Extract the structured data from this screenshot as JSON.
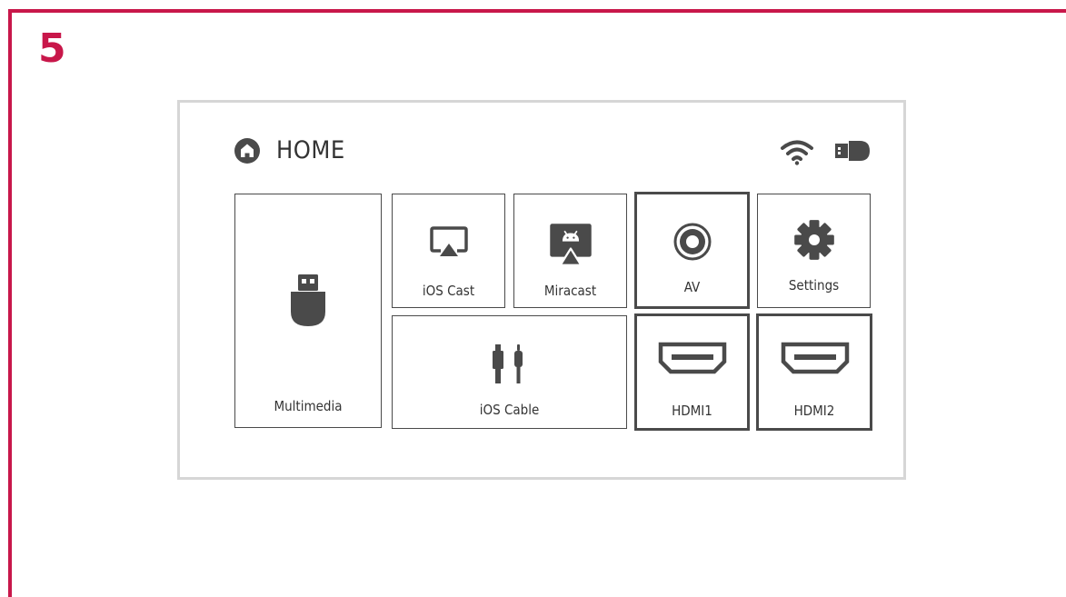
{
  "step": {
    "number": "5"
  },
  "header": {
    "title": "HOME",
    "icons": [
      "home-icon",
      "wifi-icon",
      "usb-drive-icon"
    ]
  },
  "tiles": {
    "multimedia": {
      "label": "Multimedia",
      "icon": "usb-drive-icon"
    },
    "ios_cast": {
      "label": "iOS Cast",
      "icon": "airplay-icon"
    },
    "miracast": {
      "label": "Miracast",
      "icon": "android-cast-icon"
    },
    "av": {
      "label": "AV",
      "icon": "av-jack-icon"
    },
    "settings": {
      "label": "Settings",
      "icon": "gear-icon"
    },
    "ios_cable": {
      "label": "iOS Cable",
      "icon": "lightning-cable-icon"
    },
    "hdmi1": {
      "label": "HDMI1",
      "icon": "hdmi-port-icon"
    },
    "hdmi2": {
      "label": "HDMI2",
      "icon": "hdmi-port-icon"
    }
  },
  "colors": {
    "accent": "#c8174a",
    "icon": "#4a4a4a",
    "border": "#4a4a4a",
    "screen_border": "#d6d6d6",
    "text": "#333333"
  }
}
